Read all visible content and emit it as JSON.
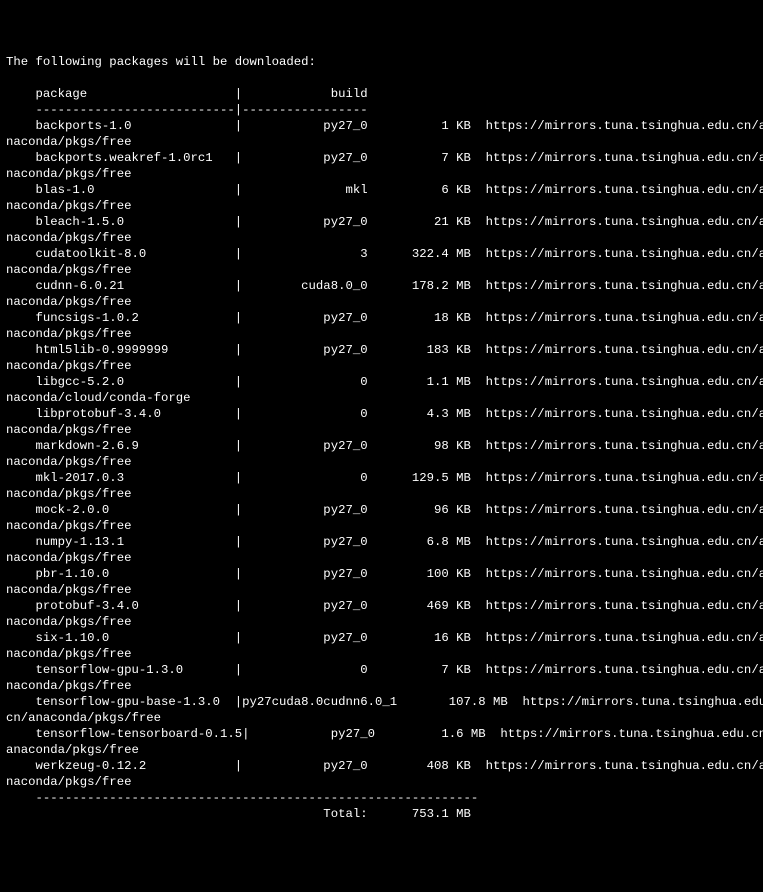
{
  "header": "The following packages will be downloaded:",
  "blank": "",
  "col_header": "    package                    |            build",
  "rule": "    ---------------------------|-----------------",
  "rows": [
    {
      "pkg": "backports-1.0",
      "build": "py27_0",
      "size": "1 KB",
      "url": "https://mirrors.tuna.tsinghua.edu.cn/a",
      "channel": "naconda/pkgs/free"
    },
    {
      "pkg": "backports.weakref-1.0rc1",
      "build": "py27_0",
      "size": "7 KB",
      "url": "https://mirrors.tuna.tsinghua.edu.cn/a",
      "channel": "naconda/pkgs/free"
    },
    {
      "pkg": "blas-1.0",
      "build": "mkl",
      "size": "6 KB",
      "url": "https://mirrors.tuna.tsinghua.edu.cn/a",
      "channel": "naconda/pkgs/free"
    },
    {
      "pkg": "bleach-1.5.0",
      "build": "py27_0",
      "size": "21 KB",
      "url": "https://mirrors.tuna.tsinghua.edu.cn/a",
      "channel": "naconda/pkgs/free"
    },
    {
      "pkg": "cudatoolkit-8.0",
      "build": "3",
      "size": "322.4 MB",
      "url": "https://mirrors.tuna.tsinghua.edu.cn/a",
      "channel": "naconda/pkgs/free"
    },
    {
      "pkg": "cudnn-6.0.21",
      "build": "cuda8.0_0",
      "size": "178.2 MB",
      "url": "https://mirrors.tuna.tsinghua.edu.cn/a",
      "channel": "naconda/pkgs/free"
    },
    {
      "pkg": "funcsigs-1.0.2",
      "build": "py27_0",
      "size": "18 KB",
      "url": "https://mirrors.tuna.tsinghua.edu.cn/a",
      "channel": "naconda/pkgs/free"
    },
    {
      "pkg": "html5lib-0.9999999",
      "build": "py27_0",
      "size": "183 KB",
      "url": "https://mirrors.tuna.tsinghua.edu.cn/a",
      "channel": "naconda/pkgs/free"
    },
    {
      "pkg": "libgcc-5.2.0",
      "build": "0",
      "size": "1.1 MB",
      "url": "https://mirrors.tuna.tsinghua.edu.cn/a",
      "channel": "naconda/cloud/conda-forge"
    },
    {
      "pkg": "libprotobuf-3.4.0",
      "build": "0",
      "size": "4.3 MB",
      "url": "https://mirrors.tuna.tsinghua.edu.cn/a",
      "channel": "naconda/pkgs/free"
    },
    {
      "pkg": "markdown-2.6.9",
      "build": "py27_0",
      "size": "98 KB",
      "url": "https://mirrors.tuna.tsinghua.edu.cn/a",
      "channel": "naconda/pkgs/free"
    },
    {
      "pkg": "mkl-2017.0.3",
      "build": "0",
      "size": "129.5 MB",
      "url": "https://mirrors.tuna.tsinghua.edu.cn/a",
      "channel": "naconda/pkgs/free"
    },
    {
      "pkg": "mock-2.0.0",
      "build": "py27_0",
      "size": "96 KB",
      "url": "https://mirrors.tuna.tsinghua.edu.cn/a",
      "channel": "naconda/pkgs/free"
    },
    {
      "pkg": "numpy-1.13.1",
      "build": "py27_0",
      "size": "6.8 MB",
      "url": "https://mirrors.tuna.tsinghua.edu.cn/a",
      "channel": "naconda/pkgs/free"
    },
    {
      "pkg": "pbr-1.10.0",
      "build": "py27_0",
      "size": "100 KB",
      "url": "https://mirrors.tuna.tsinghua.edu.cn/a",
      "channel": "naconda/pkgs/free"
    },
    {
      "pkg": "protobuf-3.4.0",
      "build": "py27_0",
      "size": "469 KB",
      "url": "https://mirrors.tuna.tsinghua.edu.cn/a",
      "channel": "naconda/pkgs/free"
    },
    {
      "pkg": "six-1.10.0",
      "build": "py27_0",
      "size": "16 KB",
      "url": "https://mirrors.tuna.tsinghua.edu.cn/a",
      "channel": "naconda/pkgs/free"
    },
    {
      "pkg": "tensorflow-gpu-1.3.0",
      "build": "0",
      "size": "7 KB",
      "url": "https://mirrors.tuna.tsinghua.edu.cn/a",
      "channel": "naconda/pkgs/free"
    }
  ],
  "special_rows": [
    {
      "line1": "    tensorflow-gpu-base-1.3.0  |py27cuda8.0cudnn6.0_1       107.8 MB  https://mirrors.tuna.tsinghua.edu.",
      "line2": "cn/anaconda/pkgs/free"
    },
    {
      "line1": "    tensorflow-tensorboard-0.1.5|           py27_0         1.6 MB  https://mirrors.tuna.tsinghua.edu.cn/",
      "line2": "anaconda/pkgs/free"
    }
  ],
  "last_row": {
    "pkg": "werkzeug-0.12.2",
    "build": "py27_0",
    "size": "408 KB",
    "url": "https://mirrors.tuna.tsinghua.edu.cn/a",
    "channel": "naconda/pkgs/free"
  },
  "bottom_rule": "    ------------------------------------------------------------",
  "total_label": "Total:",
  "total_value": "753.1 MB"
}
